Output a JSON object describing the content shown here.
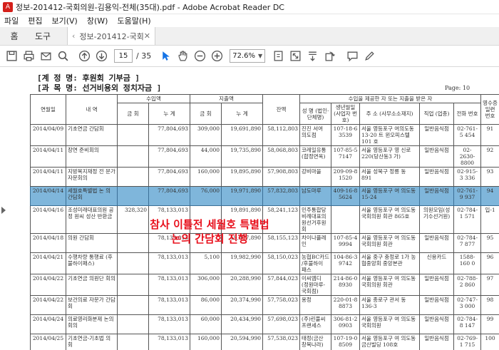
{
  "window": {
    "title": "정보-201412-국회의원-김용익-전체(35대).pdf - Adobe Acrobat Reader DC"
  },
  "menu": [
    "파일",
    "편집",
    "보기(V)",
    "창(W)",
    "도움말(H)"
  ],
  "tabs": {
    "home": "홈",
    "tools": "도구",
    "document": "정보-201412-국회..."
  },
  "toolbar": {
    "page_current": "15",
    "page_total": "/ 35",
    "zoom": "72.6%"
  },
  "document": {
    "account_title": "[계 정 명: 후원회 기부금 ]",
    "subject_title": "[과 목 명: 선거비용외 정치자금 ]",
    "page_label": "Page: 10",
    "headers": {
      "date": "연월일",
      "desc": "내 역",
      "income": "수입액",
      "expense": "지출액",
      "balance": "잔액",
      "payer": "수입을 제공한 자 또는 지출을 받은 자",
      "receipt": "영수증 일련 번호",
      "amount": "금 회",
      "total": "누 계",
      "name": "성 명 (법인·단체명)",
      "birth": "생년월일 (사업자 번 호)",
      "address": "주 소 (사무소소재지)",
      "job": "직업 (업종)",
      "phone": "전화 번호"
    },
    "rows": [
      {
        "date": "2014/04/09",
        "desc": "기초연금 간담회",
        "inc_amt": "",
        "inc_total": "77,804,693",
        "exp_amt": "309,000",
        "exp_total": "19,691,890",
        "balance": "58,112,803",
        "name": "진진 서여 의도점",
        "birth": "107-18-6 3539",
        "addr": "서울 영등포구 여의도동 13-20 트 윈오피스텔 101 호",
        "job": "일반음식점",
        "phone": "02-761-5 454",
        "receipt": "91"
      },
      {
        "date": "2014/04/11",
        "desc": "장연 준비회의",
        "inc_amt": "",
        "inc_total": "77,804,693",
        "exp_amt": "44,000",
        "exp_total": "19,735,890",
        "balance": "58,068,803",
        "name": "코레일유통 (합정면옥)",
        "birth": "107-85-5 7147",
        "addr": "서울 영등포구 영 신로220(당산동3 가)",
        "job": "일반음식점",
        "phone": "02-2630- 8800",
        "receipt": "92"
      },
      {
        "date": "2014/04/11",
        "desc": "지방복지재정 전 문가 자문회의",
        "inc_amt": "",
        "inc_total": "77,804,693",
        "exp_amt": "160,000",
        "exp_total": "19,895,890",
        "balance": "57,908,803",
        "name": "강비마을",
        "birth": "209-09-8 1520",
        "addr": "서울 성북구 정릉 동 891",
        "job": "일반음식점",
        "phone": "02-915-3 336",
        "receipt": "93"
      },
      {
        "date": "2014/04/14",
        "desc": "세월호특별법 논 의 간담회",
        "inc_amt": "",
        "inc_total": "77,804,693",
        "exp_amt": "76,000",
        "exp_total": "19,971,890",
        "balance": "57,832,803",
        "name": "남도마루",
        "birth": "409-16-8 5624",
        "addr": "서울 영등포구 여 의도동 15-24",
        "job": "일반음식점",
        "phone": "02-761-9 937",
        "receipt": "94",
        "highlight": true
      },
      {
        "date": "2014/04/16",
        "desc": "조성미래대표의원 공정 원씨 성산 반환금",
        "inc_amt": "328,320",
        "inc_total": "78,133,013",
        "exp_amt": "",
        "exp_total": "19,891,890",
        "balance": "58,241,123",
        "name": "민주통합당 비례대표의 원선거후원회",
        "birth": "",
        "addr": "서울 영등포구 여 의도동 국회의원 회관 865호",
        "job": "의원모임(성 기수선거원)",
        "phone": "02-784-1 571",
        "receipt": "입-1"
      },
      {
        "date": "2014/04/18",
        "desc": "의원 간담회",
        "inc_amt": "",
        "inc_total": "78,133,013",
        "exp_amt": "",
        "exp_total": "19,977,890",
        "balance": "58,155,123",
        "name": "차이나플레 인",
        "birth": "107-85-4 9994",
        "addr": "서울 영등포구 여 의도동 국회의원 회관",
        "job": "일반음식점",
        "phone": "02-784-7 877",
        "receipt": "95"
      },
      {
        "date": "2014/04/21",
        "desc": "수행차량 통행료 (후불하이패스)",
        "inc_amt": "",
        "inc_total": "78,133,013",
        "exp_amt": "5,100",
        "exp_total": "19,982,990",
        "balance": "58,150,023",
        "name": "농협BC카드 /후불하이 패스",
        "birth": "104-86-3 9742",
        "addr": "서울 중구 충정로 1가 농협중앙회 중앙본관",
        "job": "신용카드",
        "phone": "1588-160 0",
        "receipt": "96"
      },
      {
        "date": "2014/04/22",
        "desc": "기초연금 의원단 회의",
        "inc_amt": "",
        "inc_total": "78,133,013",
        "exp_amt": "306,000",
        "exp_total": "20,288,990",
        "balance": "57,844,023",
        "name": "이씨엠디 (정원마루- 국회점)",
        "birth": "214-86-0 8930",
        "addr": "서울 영등포구 여 의도동 국회의원 회관",
        "job": "일반음식점",
        "phone": "02-788-2 860",
        "receipt": "97"
      },
      {
        "date": "2014/04/22",
        "desc": "보건의료 자문가 간담회",
        "inc_amt": "",
        "inc_total": "78,133,013",
        "exp_amt": "86,000",
        "exp_total": "20,374,990",
        "balance": "57,758,023",
        "name": "용정",
        "birth": "220-01-8 8873",
        "addr": "서울 종로구 관서 동 136-3",
        "job": "일반음식점",
        "phone": "02-747-3 000",
        "receipt": "98"
      },
      {
        "date": "2014/04/24",
        "desc": "의료영리화분제 논의 회의",
        "inc_amt": "",
        "inc_total": "78,133,013",
        "exp_amt": "60,000",
        "exp_total": "20,434,990",
        "balance": "57,698,023",
        "name": "(주)린풀씨 프랜세스",
        "birth": "306-81-2 0903",
        "addr": "서울 영등포구 여 의도동 국회의원",
        "job": "일반음식점",
        "phone": "02-784-8 147",
        "receipt": "99"
      },
      {
        "date": "2014/04/25",
        "desc": "기초연금-기초법 의회",
        "inc_amt": "",
        "inc_total": "78,133,013",
        "exp_amt": "160,000",
        "exp_total": "20,594,990",
        "balance": "57,538,023",
        "name": "태정(금산 창목나라)",
        "birth": "107-19-0 8509",
        "addr": "서울 영등포구 여 의도동 금산빌딩 108호",
        "job": "일반음식점",
        "phone": "02-769-1 715",
        "receipt": "100"
      }
    ]
  },
  "overlay": {
    "line1": "참사 이틀전 세월호 특별법",
    "line2": "논의 간담회 진행"
  },
  "colors": {
    "highlight": "#7fb6db",
    "overlay_text": "#e8101c",
    "accent": "#1473e6"
  }
}
